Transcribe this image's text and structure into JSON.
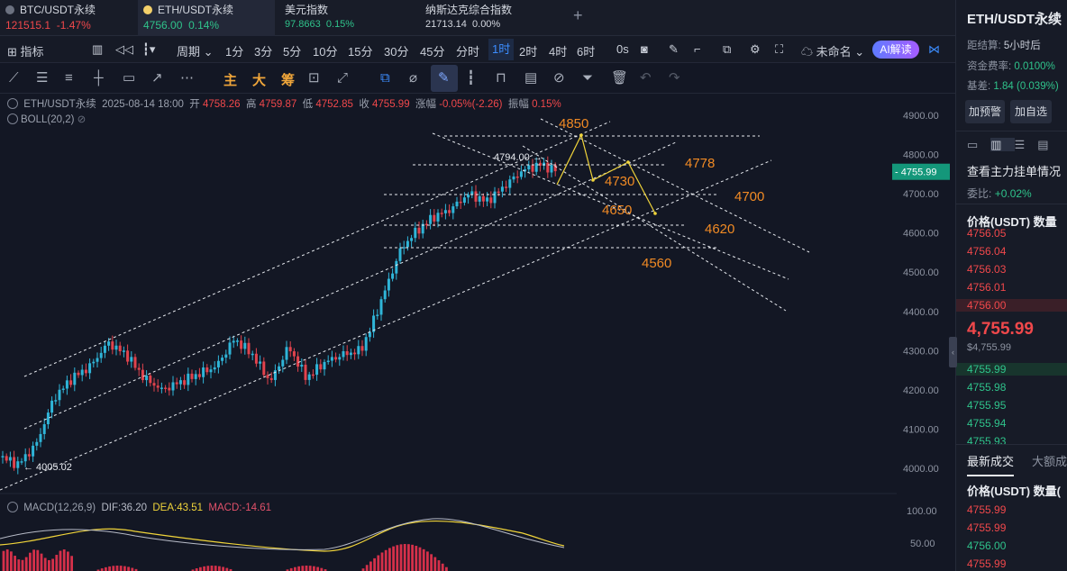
{
  "tabs": [
    {
      "name": "BTC/USDT永续",
      "price": "121515.1",
      "change": "-1.47%",
      "dir": "down"
    },
    {
      "name": "ETH/USDT永续",
      "price": "4756.00",
      "change": "0.14%",
      "dir": "up"
    },
    {
      "name": "美元指数",
      "price": "97.8663",
      "change": "0.15%",
      "dir": "up"
    },
    {
      "name": "纳斯达克综合指数",
      "price": "21713.14",
      "change": "0.00%",
      "dir": "flat"
    }
  ],
  "toolbar": {
    "indicator": "指标",
    "period": "周期",
    "intervals": [
      "1分",
      "3分",
      "5分",
      "10分",
      "15分",
      "30分",
      "45分",
      "分时",
      "1时",
      "2时",
      "4时",
      "6时",
      "0s"
    ],
    "selected": "1时",
    "layout_name": "未命名",
    "ai": "AI解读"
  },
  "draw_tools": [
    "主",
    "大",
    "筹"
  ],
  "info": {
    "symbol": "ETH/USDT永续",
    "time": "2025-08-14 18:00",
    "open_l": "开",
    "open": "4758.26",
    "high_l": "高",
    "high": "4759.87",
    "low_l": "低",
    "low": "4752.85",
    "close_l": "收",
    "close": "4755.99",
    "chg_l": "涨幅",
    "chg": "-0.05%(-2.26)",
    "amp_l": "振幅",
    "amp": "0.15%"
  },
  "boll": "BOLL(20,2)",
  "macd": {
    "name": "MACD(12,26,9)",
    "dif": "DIF:36.20",
    "dea": "DEA:43.51",
    "macd": "MACD:-14.61"
  },
  "axis": {
    "price_ticks": [
      "4900.00",
      "4800.00",
      "4700.00",
      "4600.00",
      "4500.00",
      "4400.00",
      "4300.00",
      "4200.00",
      "4100.00",
      "4000.00"
    ],
    "current": "4755.99",
    "macd_ticks": [
      "100.00",
      "50.00"
    ]
  },
  "annotations": {
    "high_label": "4794.00",
    "low_label": "← 4005.02",
    "levels": [
      "4850",
      "4778",
      "4730",
      "4700",
      "4650",
      "4620",
      "4560"
    ]
  },
  "right": {
    "title": "ETH/USDT永续",
    "settle_l": "距结算:",
    "settle": "5小时后",
    "fund_l": "资金费率:",
    "fund": "0.0100%",
    "basis_l": "基差:",
    "basis": "1.84 (0.039%)",
    "btn_alert": "加预警",
    "btn_watch": "加自选",
    "orders_title": "查看主力挂单情况",
    "ratio_l": "委比:",
    "ratio": "+0.02%",
    "book_header": "价格(USDT)  数量",
    "asks": [
      "4756.05",
      "4756.04",
      "4756.03",
      "4756.01",
      "4756.00"
    ],
    "last": "4,755.99",
    "last_usd": "$4,755.99",
    "bids": [
      "4755.99",
      "4755.98",
      "4755.95",
      "4755.94",
      "4755.93"
    ],
    "trades_tab": "最新成交",
    "big_tab": "大额成",
    "trades_header": "价格(USDT)  数量(",
    "trades": [
      "4755.99",
      "4755.99",
      "4756.00",
      "4755.99"
    ]
  },
  "colors": {
    "up": "#2fc38b",
    "down": "#f0484b",
    "accent": "#3c8dff",
    "orange": "#f08a24"
  }
}
